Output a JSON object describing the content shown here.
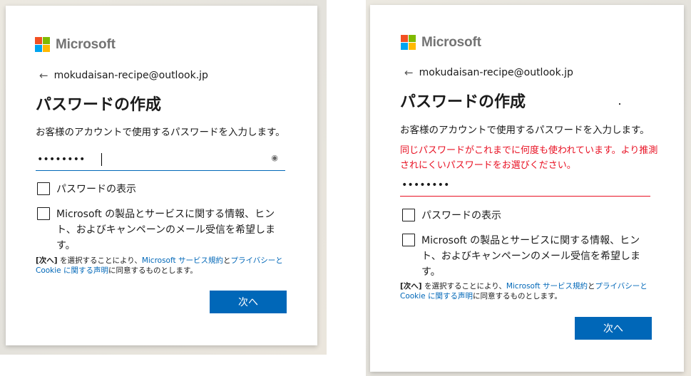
{
  "brand": {
    "name": "Microsoft"
  },
  "left": {
    "identity": {
      "back_icon": "←",
      "email": "mokudaisan-recipe@outlook.jp"
    },
    "title": "パスワードの作成",
    "description": "お客様のアカウントで使用するパスワードを入力します。",
    "password": {
      "value": "••••••••",
      "eye_icon": "◉"
    },
    "show_password_label": "パスワードの表示",
    "marketing_label": "Microsoft の製品とサービスに関する情報、ヒント、およびキャンペーンのメール受信を希望します。",
    "terms": {
      "next_ref": "[次へ]",
      "text1": " を選択することにより、",
      "link1": "Microsoft サービス規約",
      "and": "と",
      "link2a": "プライバシーと",
      "link2b": "Cookie に関する声明",
      "text2": "に同意するものとします。"
    },
    "next_button": "次へ"
  },
  "right": {
    "identity": {
      "back_icon": "←",
      "email": "mokudaisan-recipe@outlook.jp"
    },
    "title": "パスワードの作成",
    "description": "お客様のアカウントで使用するパスワードを入力します。",
    "error_line1": "同じパスワードがこれまでに何度も使われています。より推測",
    "error_line2": "されにくいパスワードをお選びください。",
    "password": {
      "value": "••••••••"
    },
    "show_password_label": "パスワードの表示",
    "marketing_label": "Microsoft の製品とサービスに関する情報、ヒント、およびキャンペーンのメール受信を希望します。",
    "terms": {
      "next_ref": "[次へ]",
      "text1": " を選択することにより、",
      "link1": "Microsoft サービス規約",
      "and": "と",
      "link2a": "プライバシーと",
      "link2b": "Cookie に関する声明",
      "text2": "に同意するものとします。"
    },
    "next_button": "次へ"
  },
  "colors": {
    "accent": "#0067b8",
    "error": "#e81123"
  }
}
